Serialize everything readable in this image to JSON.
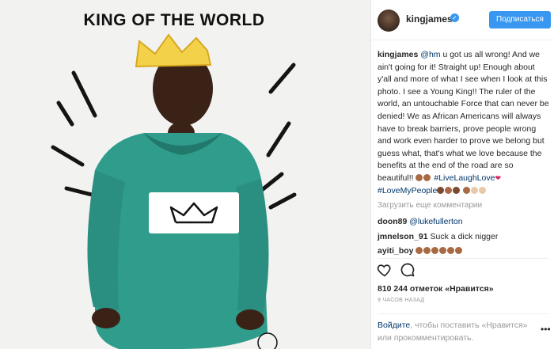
{
  "photo": {
    "title": "KING OF THE WORLD"
  },
  "header": {
    "username": "kingjames",
    "follow_label": "Подписаться"
  },
  "caption": {
    "username": "kingjames",
    "mention": "@hm",
    "text": " u got us all wrong! And we ain't going for it! Straight up! Enough about y'all and more of what I see when I look at this photo. I see a Young King!! The ruler of the world, an untouchable Force that can never be denied! We as African Americans will always have to break barriers, prove people wrong and work even harder to prove we belong but guess what, that's what we love because the benefits at the end of the road are so beautiful!! ",
    "hashtag1": "#LiveLaughLove",
    "hashtag2": "#LoveMyPeople"
  },
  "comments": {
    "load_more": "Загрузить еще комментарии",
    "items": [
      {
        "user": "doon89",
        "text": "@lukefullerton"
      },
      {
        "user": "jmnelson_91",
        "text": "Suck a dick nigger"
      },
      {
        "user": "ayiti_boy",
        "text": ""
      }
    ]
  },
  "likes": "810 244 отметок «Нравится»",
  "time": "9 ЧАСОВ НАЗАД",
  "login": {
    "link": "Войдите",
    "text1": ", чтобы поставить «Нравится»",
    "text2": "или прокомментировать."
  },
  "icons": [
    "heart-icon",
    "comment-icon",
    "more-icon",
    "crown-icon",
    "verified-badge"
  ],
  "colors": {
    "accent": "#3897f0",
    "link": "#003569",
    "hoodie": "#2f9c8c",
    "crown": "#f3d24a"
  }
}
